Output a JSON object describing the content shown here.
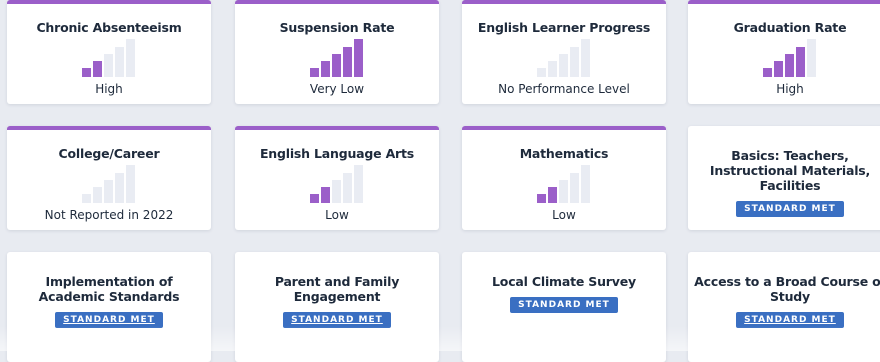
{
  "colors": {
    "accent": "#9b5fc9",
    "badge": "#3a6fc2",
    "bar_empty": "#e9ecf3"
  },
  "cards": [
    {
      "title": "Chronic Absenteeism",
      "status": "High",
      "filled_bars": 2,
      "icon": "performance-bars-icon"
    },
    {
      "title": "Suspension Rate",
      "status": "Very Low",
      "filled_bars": 5,
      "icon": "performance-bars-icon"
    },
    {
      "title": "English Learner Progress",
      "status": "No Performance Level",
      "filled_bars": 0,
      "icon": "performance-bars-icon"
    },
    {
      "title": "Graduation Rate",
      "status": "High",
      "filled_bars": 4,
      "icon": "performance-bars-icon"
    },
    {
      "title": "College/Career",
      "status": "Not Reported in 2022",
      "filled_bars": 0,
      "icon": "performance-bars-icon"
    },
    {
      "title": "English Language Arts",
      "status": "Low",
      "filled_bars": 2,
      "icon": "performance-bars-icon"
    },
    {
      "title": "Mathematics",
      "status": "Low",
      "filled_bars": 2,
      "icon": "performance-bars-icon"
    },
    {
      "title": "Basics: Teachers, Instructional Materials, Facilities",
      "badge": "STANDARD MET"
    },
    {
      "title": "Implementation of Academic Standards",
      "badge": "STANDARD MET"
    },
    {
      "title": "Parent and Family Engagement",
      "badge": "STANDARD MET"
    },
    {
      "title": "Local Climate Survey",
      "badge": "STANDARD MET"
    },
    {
      "title": "Access to a Broad Course of Study",
      "badge": "STANDARD MET"
    }
  ]
}
